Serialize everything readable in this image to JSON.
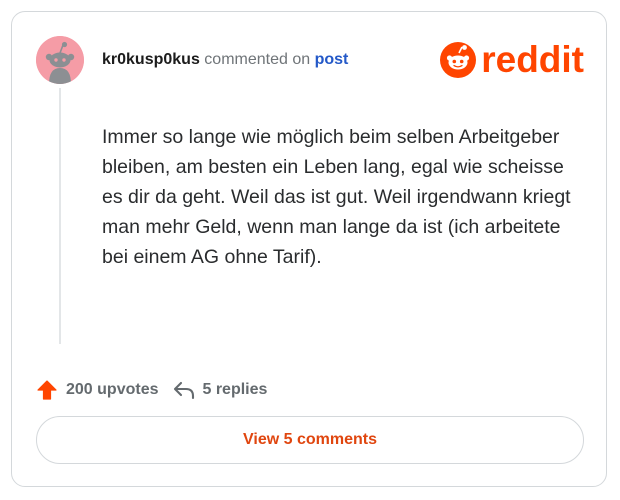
{
  "comment": {
    "username": "kr0kusp0kus",
    "action_text": "commented on",
    "target_link": "post",
    "body": "Immer so lange wie möglich beim selben Arbeitgeber bleiben, am besten ein Leben lang, egal wie scheisse es dir da geht. Weil das ist gut. Weil irgendwann kriegt man mehr Geld, wenn man lange da ist (ich arbeitete bei einem AG ohne Tarif).",
    "avatar_icon": "snoo-avatar-icon",
    "avatar_color": "#f59ca6"
  },
  "brand": {
    "name": "reddit",
    "color": "#ff4500",
    "icon": "snoo-logo-icon"
  },
  "stats": {
    "upvotes_label": "200 upvotes",
    "upvote_icon": "upvote-arrow-icon",
    "upvote_color": "#ff4500",
    "replies_label": "5 replies",
    "reply_icon": "reply-arrow-icon"
  },
  "actions": {
    "view_comments_label": "View 5 comments",
    "accent_color": "#e0460f"
  }
}
